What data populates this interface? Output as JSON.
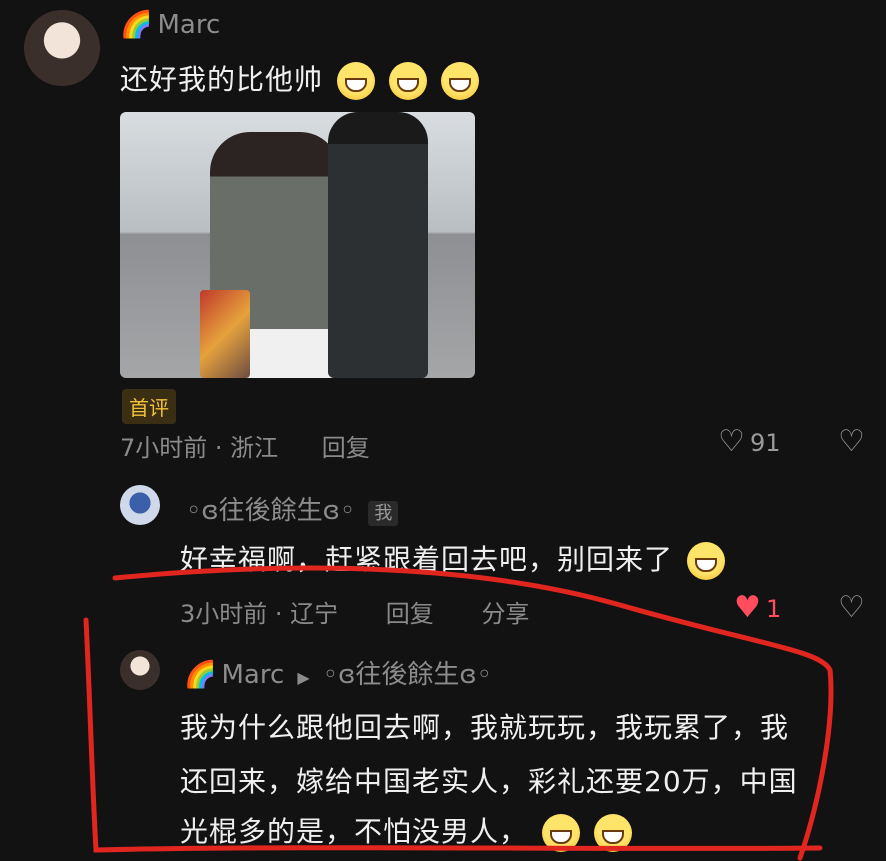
{
  "comment1": {
    "rainbow": "🌈",
    "author": "Marc",
    "text": "还好我的比他帅",
    "badge": "首评",
    "time_location": "7小时前 · 浙江",
    "reply_label": "回复",
    "likes": "91",
    "emoji_icons": [
      "grinning-face-icon",
      "grinning-face-icon",
      "grinning-face-icon"
    ]
  },
  "reply1": {
    "author": "◦ɞ往後餘生ɞ◦",
    "me_tag": "我",
    "text": "好幸福啊，赶紧跟着回去吧，别回来了",
    "time_location": "3小时前 · 辽宁",
    "reply_label": "回复",
    "share_label": "分享",
    "likes": "1"
  },
  "reply2": {
    "rainbow": "🌈",
    "author": "Marc",
    "arrow": "▶",
    "target": "◦ɞ往後餘生ɞ◦",
    "line1": "我为什么跟他回去啊，我就玩玩，我玩累了，我",
    "line2": "还回来，嫁给中国老实人，彩礼还要20万，中国",
    "line3": "光棍多的是，不怕没男人，"
  },
  "colors": {
    "background": "#121212",
    "annotation_red": "#e0261f",
    "like_red": "#ff4d5e",
    "badge_gold": "#f3c23b"
  }
}
